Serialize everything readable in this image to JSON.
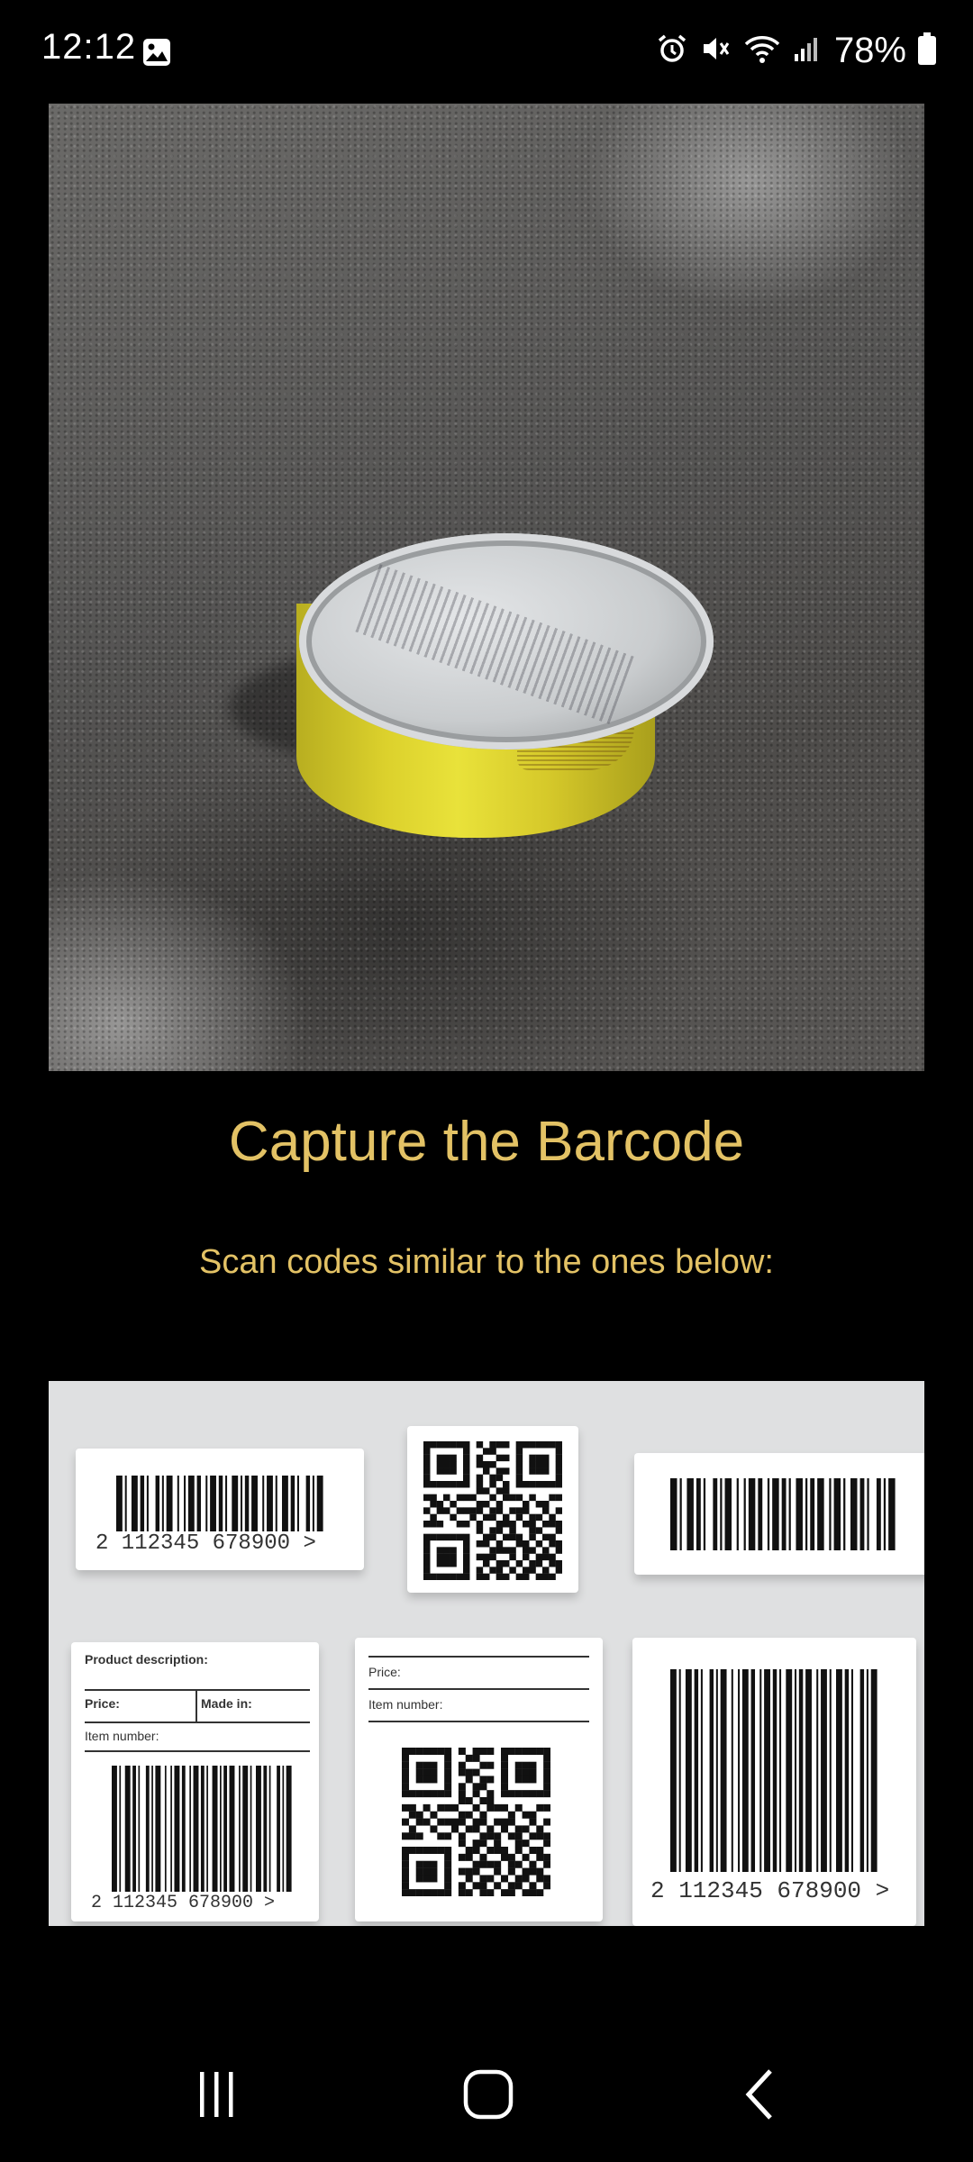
{
  "status_bar": {
    "time": "12:12",
    "battery_percent": "78%"
  },
  "heading": {
    "title": "Capture the Barcode",
    "subtitle": "Scan codes similar to the ones below:"
  },
  "samples": {
    "barcode_digits": "2 112345 678900 >",
    "label_product_description": "Product description:",
    "label_price": "Price:",
    "label_made_in": "Made in:",
    "label_item_number": "Item number:"
  },
  "colors": {
    "accent": "#e3c265",
    "background": "#000000"
  }
}
